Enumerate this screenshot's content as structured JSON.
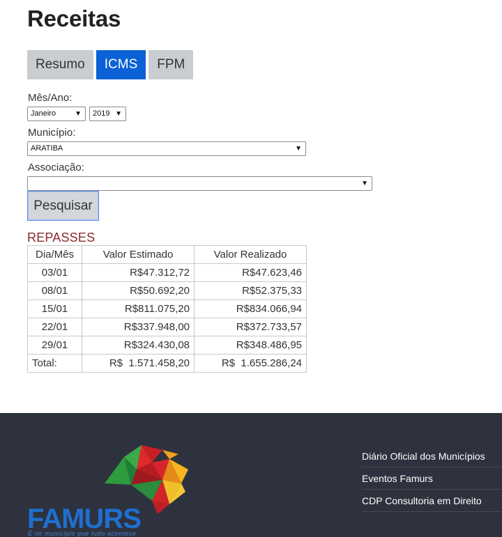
{
  "page": {
    "title": "Receitas"
  },
  "tabs": [
    {
      "label": "Resumo",
      "active": false
    },
    {
      "label": "ICMS",
      "active": true
    },
    {
      "label": "FPM",
      "active": false
    }
  ],
  "form": {
    "month_year_label": "Mês/Ano:",
    "month_value": "Janeiro",
    "year_value": "2019",
    "municipio_label": "Município:",
    "municipio_value": "ARATIBA",
    "associacao_label": "Associação:",
    "associacao_value": "",
    "search_button": "Pesquisar"
  },
  "repasses": {
    "title": "REPASSES",
    "headers": [
      "Dia/Mês",
      "Valor Estimado",
      "Valor Realizado"
    ],
    "rows": [
      [
        "03/01",
        "R$47.312,72",
        "R$47.623,46"
      ],
      [
        "08/01",
        "R$50.692,20",
        "R$52.375,33"
      ],
      [
        "15/01",
        "R$811.075,20",
        "R$834.066,94"
      ],
      [
        "22/01",
        "R$337.948,00",
        "R$372.733,57"
      ],
      [
        "29/01",
        "R$324.430,08",
        "R$348.486,95"
      ]
    ],
    "total_label": "Total:",
    "total_estimado": "R$  1.571.458,20",
    "total_realizado": "R$  1.655.286,24"
  },
  "footer": {
    "links": [
      "Diário Oficial dos Municípios",
      "Eventos Famurs",
      "CDP Consultoria em Direito"
    ],
    "logo_text": "FAMURS",
    "logo_tagline": "É no município que tudo acontece"
  },
  "colors": {
    "accent": "#0b62d6",
    "footer_bg": "#2e323e",
    "section_title": "#8a2a2a"
  },
  "icons": {
    "select_caret": "▼"
  }
}
